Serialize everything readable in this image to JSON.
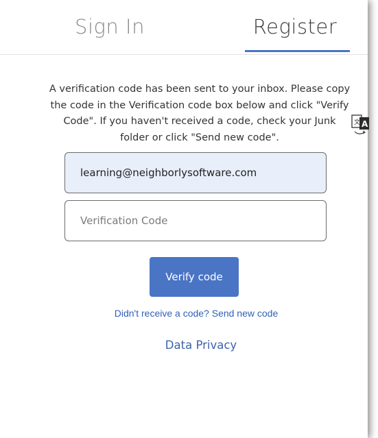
{
  "tabs": [
    {
      "label": "Sign In",
      "active": false
    },
    {
      "label": "Register",
      "active": true
    }
  ],
  "instructions": "A verification code has been sent to your inbox. Please copy the code in the Verification code box below and click \"Verify Code\". If you haven't received a code, check your Junk folder or click \"Send new code\".",
  "email_field": {
    "value": "learning@neighborlysoftware.com"
  },
  "code_field": {
    "value": "",
    "placeholder": "Verification Code"
  },
  "verify_button": {
    "label": "Verify code"
  },
  "resend_link": {
    "label": "Didn't receive a code? Send new code"
  },
  "privacy_link": {
    "label": "Data Privacy"
  },
  "icons": {
    "translate": "translate-icon"
  },
  "colors": {
    "accent": "#4a74c4",
    "link": "#2f61b8",
    "email_bg": "#e8eefa"
  }
}
